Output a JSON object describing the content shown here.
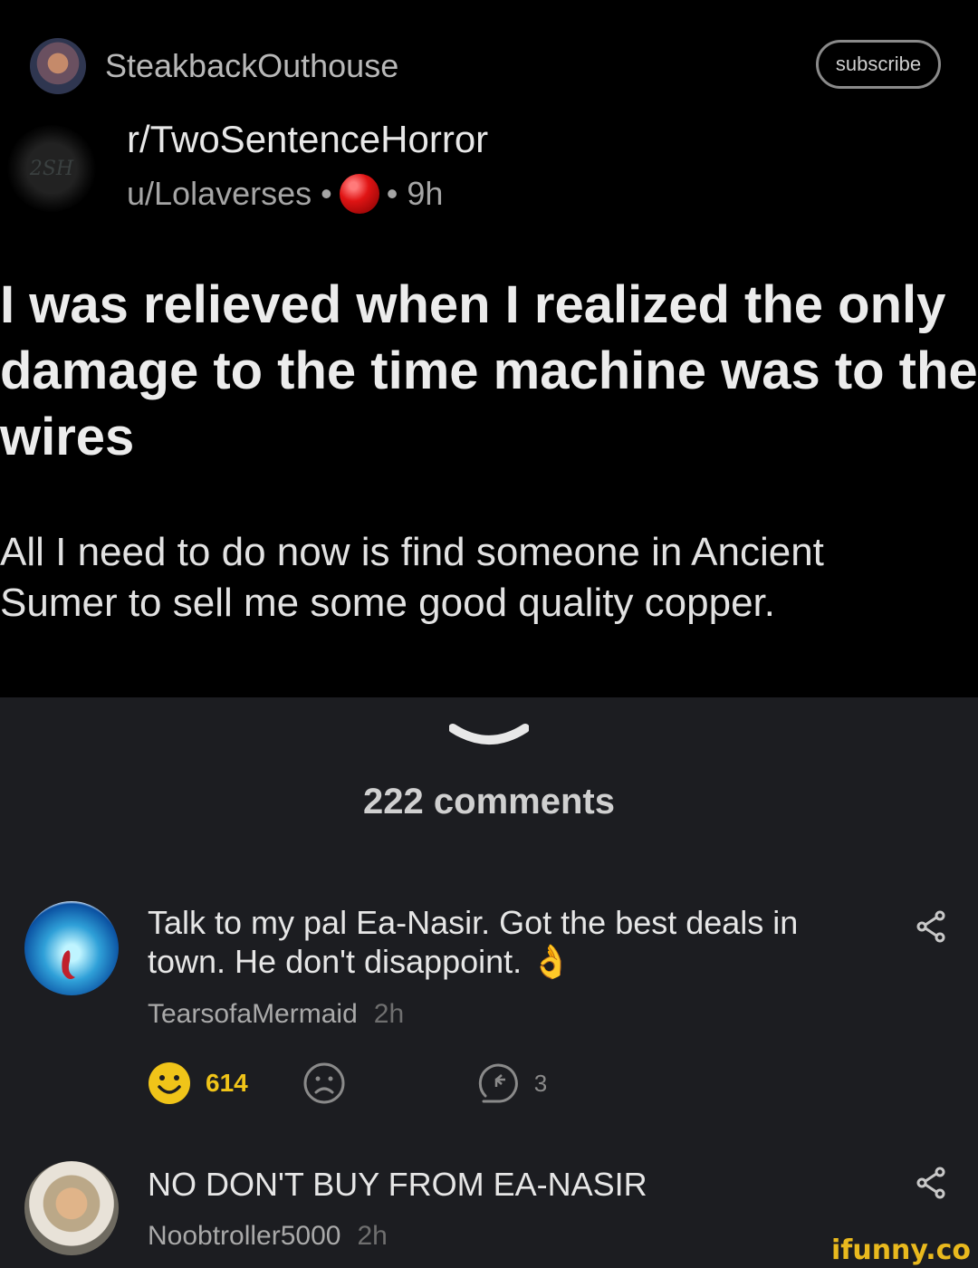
{
  "post": {
    "poster_name": "SteakbackOuthouse",
    "subscribe_label": "subscribe",
    "subreddit_icon_text": "2SH",
    "subreddit": "r/TwoSentenceHorror",
    "author": "u/Lolaverses •",
    "age": "• 9h",
    "title": "I was relieved when I realized the only\ndamage to the time machine was to the\nwires",
    "body": "All I need to do now is find someone in Ancient\nSumer to sell me some good quality copper."
  },
  "comments_section": {
    "count_label": "222 comments"
  },
  "comments": [
    {
      "text": "Talk to my pal Ea-Nasir. Got the best deals in\ntown. He don't disappoint. 👌",
      "user": "TearsofaMermaid",
      "time": "2h",
      "smile_count": "614",
      "reply_count": "3"
    },
    {
      "text": "NO DON'T BUY FROM EA-NASIR",
      "user": "Noobtroller5000",
      "time": "2h"
    }
  ],
  "watermark": "ifunny.co",
  "colors": {
    "accent_yellow": "#f0c419",
    "award_red": "#e01414"
  }
}
